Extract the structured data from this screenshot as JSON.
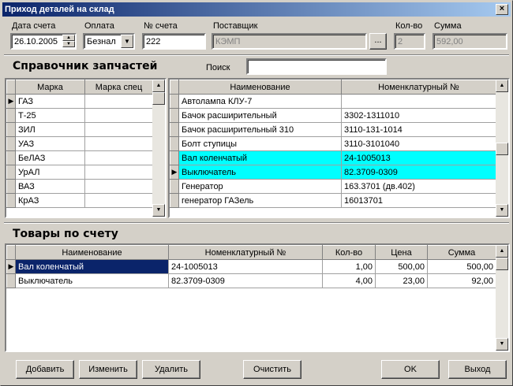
{
  "window": {
    "title": "Приход деталей на склад",
    "close": "×"
  },
  "invoice": {
    "date_label": "Дата счета",
    "date_value": "26.10.2005",
    "payment_label": "Оплата",
    "payment_value": "Безнал",
    "number_label": "№ счета",
    "number_value": "222",
    "supplier_label": "Поставщик",
    "supplier_value": "КЭМП",
    "supplier_btn": "...",
    "qty_label": "Кол-во",
    "qty_value": "2",
    "sum_label": "Сумма",
    "sum_value": "592,00"
  },
  "catalog": {
    "title": "Справочник запчастей",
    "search_label": "Поиск",
    "search_value": "",
    "brands": {
      "col_brand": "Марка",
      "col_brand_spec": "Марка спец",
      "rows": [
        {
          "brand": "ГАЗ",
          "spec": ""
        },
        {
          "brand": "Т-25",
          "spec": ""
        },
        {
          "brand": "ЗИЛ",
          "spec": ""
        },
        {
          "brand": "УАЗ",
          "spec": ""
        },
        {
          "brand": "БеЛАЗ",
          "spec": ""
        },
        {
          "brand": "УрАЛ",
          "spec": ""
        },
        {
          "brand": "ВАЗ",
          "spec": ""
        },
        {
          "brand": "КрАЗ",
          "spec": ""
        }
      ]
    },
    "parts": {
      "col_name": "Наименование",
      "col_number": "Номенклатурный №",
      "rows": [
        {
          "name": "Автолампа КЛУ-7",
          "number": ""
        },
        {
          "name": "Бачок расширительный",
          "number": "3302-1311010"
        },
        {
          "name": "Бачок расширительный 310",
          "number": "3110-131-1014"
        },
        {
          "name": "Болт ступицы",
          "number": "3110-3101040"
        },
        {
          "name": "Вал коленчатый",
          "number": "24-1005013"
        },
        {
          "name": "Выключатель",
          "number": "82.3709-0309"
        },
        {
          "name": "Генератор",
          "number": "163.3701 (дв.402)"
        },
        {
          "name": "генератор ГАЗель",
          "number": "16013701"
        }
      ]
    }
  },
  "goods": {
    "title": "Товары по счету",
    "col_name": "Наименование",
    "col_number": "Номенклатурный №",
    "col_qty": "Кол-во",
    "col_price": "Цена",
    "col_sum": "Сумма",
    "rows": [
      {
        "name": "Вал коленчатый",
        "number": "24-1005013",
        "qty": "1,00",
        "price": "500,00",
        "sum": "500,00"
      },
      {
        "name": "Выключатель",
        "number": "82.3709-0309",
        "qty": "4,00",
        "price": "23,00",
        "sum": "92,00"
      }
    ]
  },
  "buttons": {
    "add": "Добавить",
    "edit": "Изменить",
    "delete": "Удалить",
    "clear": "Очистить",
    "ok": "OK",
    "exit": "Выход"
  },
  "glyphs": {
    "row_pointer": "▶",
    "up": "▲",
    "down": "▼",
    "dropdown": "▼"
  }
}
